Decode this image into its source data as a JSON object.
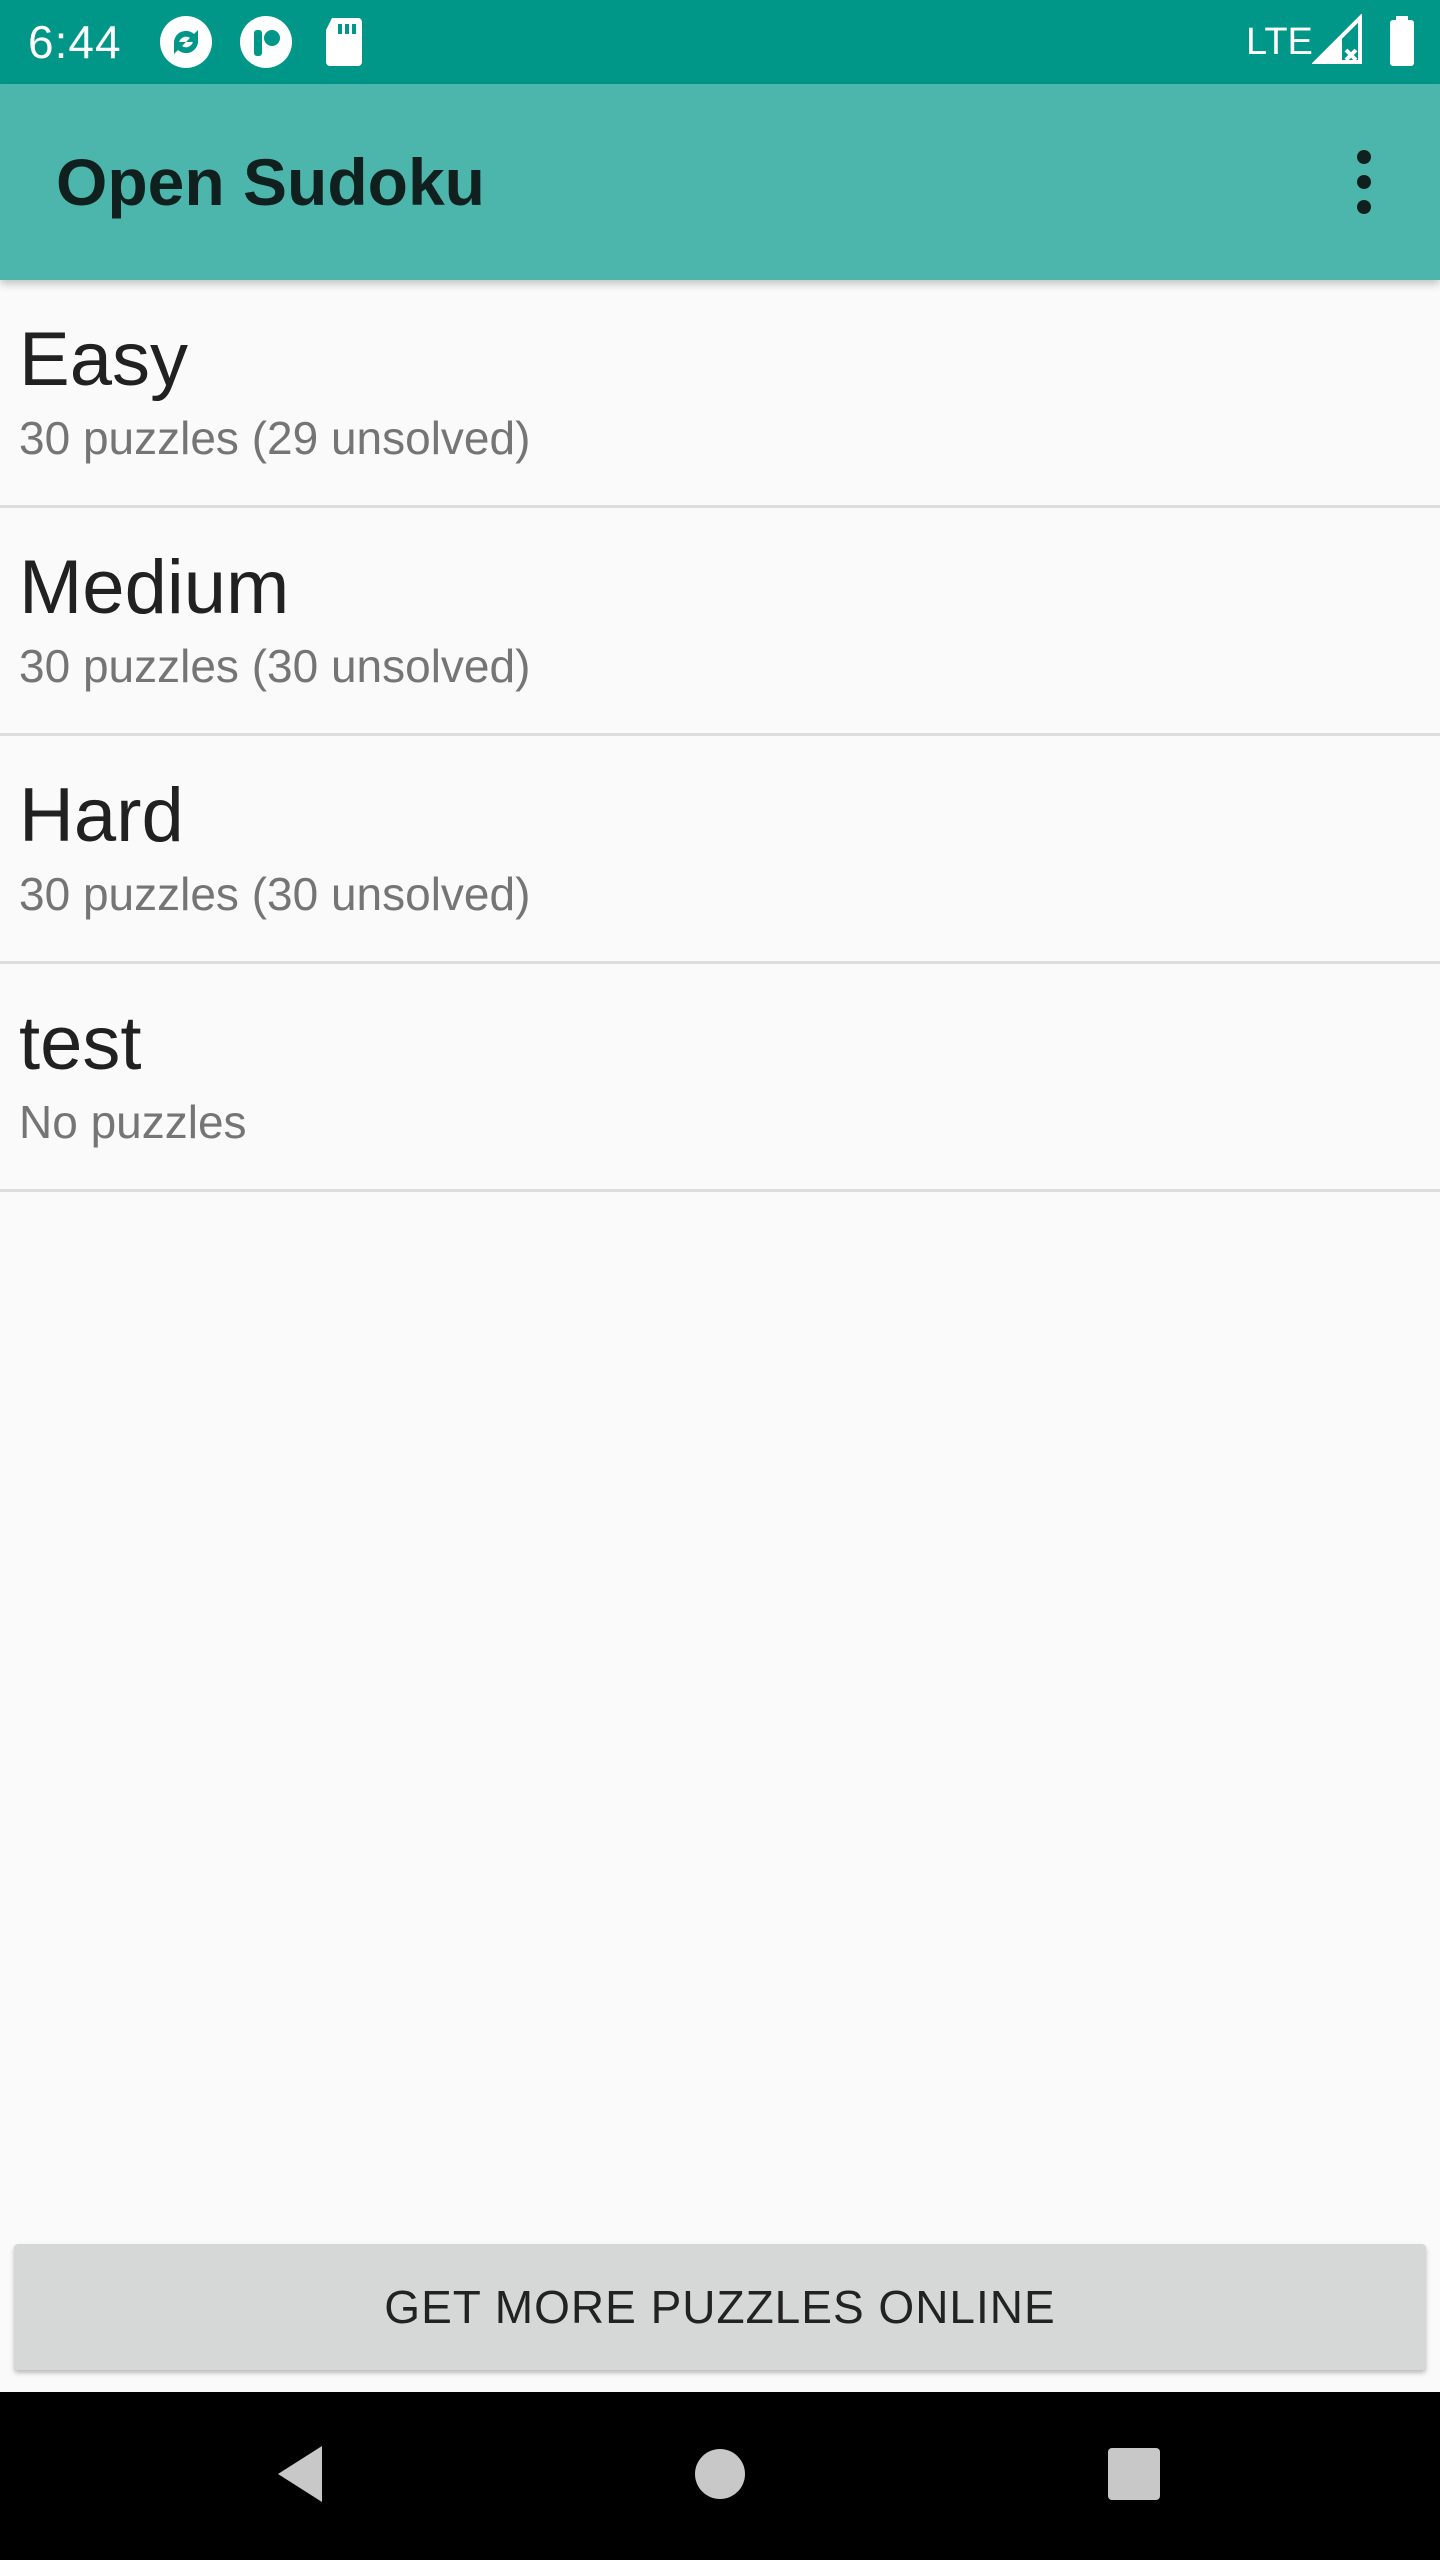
{
  "status_bar": {
    "time": "6:44",
    "network": "LTE",
    "icons": [
      "sync-icon",
      "notification-icon",
      "sd-card-icon",
      "signal-icon",
      "battery-icon"
    ]
  },
  "app_bar": {
    "title": "Open Sudoku",
    "overflow_icon": "more-vert-icon"
  },
  "folders": [
    {
      "name": "Easy",
      "summary": "30 puzzles (29 unsolved)"
    },
    {
      "name": "Medium",
      "summary": "30 puzzles (30 unsolved)"
    },
    {
      "name": "Hard",
      "summary": "30 puzzles (30 unsolved)"
    },
    {
      "name": "test",
      "summary": "No puzzles"
    }
  ],
  "footer": {
    "get_more_label": "GET MORE PUZZLES ONLINE"
  },
  "nav_bar": {
    "buttons": [
      "back-icon",
      "home-icon",
      "recents-icon"
    ]
  },
  "colors": {
    "status_bar": "#009688",
    "app_bar": "#4db6ac",
    "background": "#fafafa",
    "button": "#d6d7d7"
  }
}
